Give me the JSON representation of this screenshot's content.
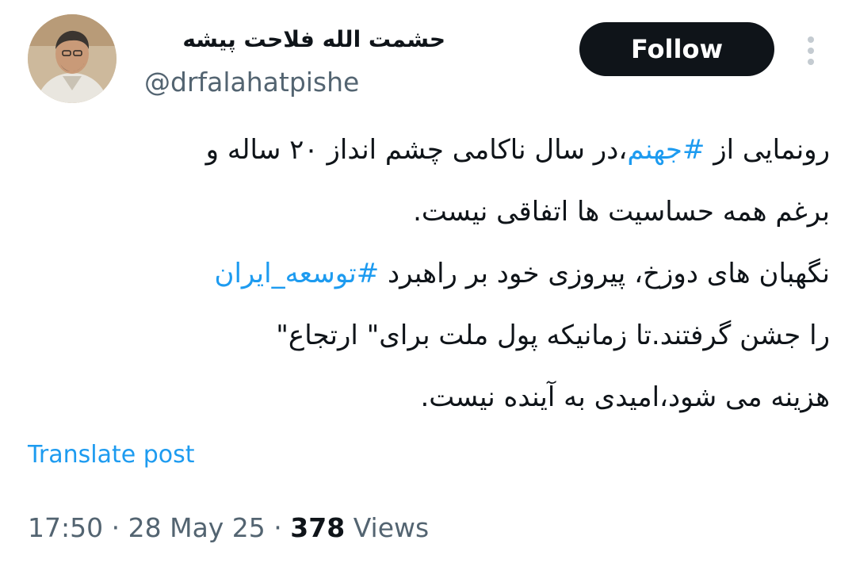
{
  "author": {
    "display_name": "حشمت الله فلاحت پیشه",
    "handle": "@drfalahatpishe"
  },
  "actions": {
    "follow_label": "Follow",
    "more_icon": "more-vertical-icon"
  },
  "post": {
    "line1": {
      "before": "رونمایی از ",
      "hashtag": "#جهنم",
      "after": "،در سال ناکامی چشم انداز ۲۰ ساله و"
    },
    "line2": "برغم همه حساسیت ها اتفاقی نیست.",
    "line3": {
      "before": "نگهبان های دوزخ، پیروزی خود بر راهبرد ",
      "hashtag": "#توسعه_ایران"
    },
    "line4": "را جشن گرفتند.تا زمانیکه  پول ملت برای\" ارتجاع\"",
    "line5": "هزینه می شود،امیدی به آینده نیست."
  },
  "translate_label": "Translate post",
  "meta": {
    "time": "17:50",
    "separator": "·",
    "date": "28 May 25",
    "views_count": "378",
    "views_label": "Views"
  },
  "colors": {
    "text": "#0f1419",
    "secondary": "#536471",
    "link": "#1d9bf0",
    "follow_bg": "#0f1419",
    "follow_text": "#ffffff"
  }
}
